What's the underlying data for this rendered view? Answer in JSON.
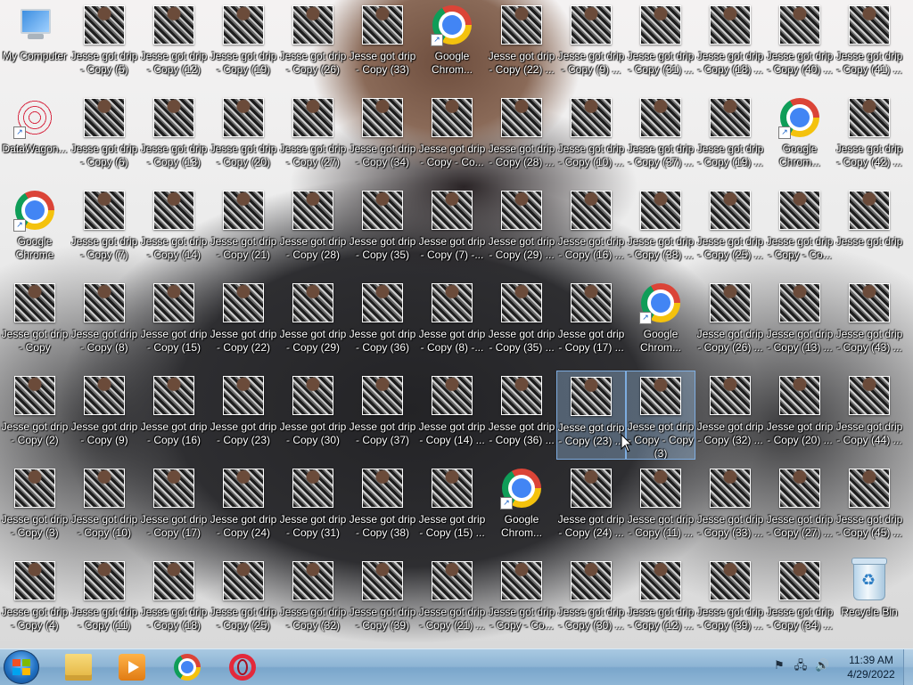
{
  "desktop": {
    "icons": [
      {
        "label": "My Computer",
        "type": "computer"
      },
      {
        "label": "Jesse got drip - Copy (5)",
        "type": "photo"
      },
      {
        "label": "Jesse got drip - Copy (12)",
        "type": "photo"
      },
      {
        "label": "Jesse got drip - Copy (19)",
        "type": "photo"
      },
      {
        "label": "Jesse got drip - Copy (26)",
        "type": "photo"
      },
      {
        "label": "Jesse got drip - Copy (33)",
        "type": "photo"
      },
      {
        "label": "Google Chrom...",
        "type": "chrome"
      },
      {
        "label": "Jesse got drip - Copy (22) ...",
        "type": "photo"
      },
      {
        "label": "Jesse got drip - Copy (9) ...",
        "type": "photo"
      },
      {
        "label": "Jesse got drip - Copy (31) ...",
        "type": "photo"
      },
      {
        "label": "Jesse got drip - Copy (18) ...",
        "type": "photo"
      },
      {
        "label": "Jesse got drip - Copy (40) ...",
        "type": "photo"
      },
      {
        "label": "Jesse got drip - Copy (41) ...",
        "type": "photo"
      },
      {
        "label": "DataWagon...",
        "type": "datawagon"
      },
      {
        "label": "Jesse got drip - Copy (6)",
        "type": "photo"
      },
      {
        "label": "Jesse got drip - Copy (13)",
        "type": "photo"
      },
      {
        "label": "Jesse got drip - Copy (20)",
        "type": "photo"
      },
      {
        "label": "Jesse got drip - Copy (27)",
        "type": "photo"
      },
      {
        "label": "Jesse got drip - Copy (34)",
        "type": "photo"
      },
      {
        "label": "Jesse got drip - Copy - Co...",
        "type": "photo"
      },
      {
        "label": "Jesse got drip - Copy (28) ...",
        "type": "photo"
      },
      {
        "label": "Jesse got drip - Copy (10) ...",
        "type": "photo"
      },
      {
        "label": "Jesse got drip - Copy (37) ...",
        "type": "photo"
      },
      {
        "label": "Jesse got drip - Copy (19) ...",
        "type": "photo"
      },
      {
        "label": "Google Chrom...",
        "type": "chrome"
      },
      {
        "label": "Jesse got drip - Copy (42) ...",
        "type": "photo"
      },
      {
        "label": "Google Chrome",
        "type": "chrome"
      },
      {
        "label": "Jesse got drip - Copy (7)",
        "type": "photo"
      },
      {
        "label": "Jesse got drip - Copy (14)",
        "type": "photo"
      },
      {
        "label": "Jesse got drip - Copy (21)",
        "type": "photo"
      },
      {
        "label": "Jesse got drip - Copy (28)",
        "type": "photo"
      },
      {
        "label": "Jesse got drip - Copy (35)",
        "type": "photo"
      },
      {
        "label": "Jesse got drip - Copy (7) -...",
        "type": "photo"
      },
      {
        "label": "Jesse got drip - Copy (29) ...",
        "type": "photo"
      },
      {
        "label": "Jesse got drip - Copy (16) ...",
        "type": "photo"
      },
      {
        "label": "Jesse got drip - Copy (38) ...",
        "type": "photo"
      },
      {
        "label": "Jesse got drip - Copy (25) ...",
        "type": "photo"
      },
      {
        "label": "Jesse got drip - Copy - Co...",
        "type": "photo"
      },
      {
        "label": "Jesse got drip",
        "type": "photo"
      },
      {
        "label": "Jesse got drip - Copy",
        "type": "photo"
      },
      {
        "label": "Jesse got drip - Copy (8)",
        "type": "photo"
      },
      {
        "label": "Jesse got drip - Copy (15)",
        "type": "photo"
      },
      {
        "label": "Jesse got drip - Copy (22)",
        "type": "photo"
      },
      {
        "label": "Jesse got drip - Copy (29)",
        "type": "photo"
      },
      {
        "label": "Jesse got drip - Copy (36)",
        "type": "photo"
      },
      {
        "label": "Jesse got drip - Copy (8) -...",
        "type": "photo"
      },
      {
        "label": "Jesse got drip - Copy (35) ...",
        "type": "photo"
      },
      {
        "label": "Jesse got drip - Copy (17) ...",
        "type": "photo"
      },
      {
        "label": "Google Chrom...",
        "type": "chrome"
      },
      {
        "label": "Jesse got drip - Copy (26) ...",
        "type": "photo"
      },
      {
        "label": "Jesse got drip - Copy (13) ...",
        "type": "photo"
      },
      {
        "label": "Jesse got drip - Copy (43) ...",
        "type": "photo"
      },
      {
        "label": "Jesse got drip - Copy (2)",
        "type": "photo"
      },
      {
        "label": "Jesse got drip - Copy (9)",
        "type": "photo"
      },
      {
        "label": "Jesse got drip - Copy (16)",
        "type": "photo"
      },
      {
        "label": "Jesse got drip - Copy (23)",
        "type": "photo"
      },
      {
        "label": "Jesse got drip - Copy (30)",
        "type": "photo"
      },
      {
        "label": "Jesse got drip - Copy (37)",
        "type": "photo"
      },
      {
        "label": "Jesse got drip - Copy (14) ...",
        "type": "photo"
      },
      {
        "label": "Jesse got drip - Copy (36) ...",
        "type": "photo"
      },
      {
        "label": "Jesse got drip - Copy (23) ...",
        "type": "photo",
        "selected": true
      },
      {
        "label": "Jesse got drip - Copy - Copy (3)",
        "type": "photo",
        "selected": true
      },
      {
        "label": "Jesse got drip - Copy (32) ...",
        "type": "photo"
      },
      {
        "label": "Jesse got drip - Copy (20) ...",
        "type": "photo"
      },
      {
        "label": "Jesse got drip - Copy (44) ...",
        "type": "photo"
      },
      {
        "label": "Jesse got drip - Copy (3)",
        "type": "photo"
      },
      {
        "label": "Jesse got drip - Copy (10)",
        "type": "photo"
      },
      {
        "label": "Jesse got drip - Copy (17)",
        "type": "photo"
      },
      {
        "label": "Jesse got drip - Copy (24)",
        "type": "photo"
      },
      {
        "label": "Jesse got drip - Copy (31)",
        "type": "photo"
      },
      {
        "label": "Jesse got drip - Copy (38)",
        "type": "photo"
      },
      {
        "label": "Jesse got drip - Copy (15) ...",
        "type": "photo"
      },
      {
        "label": "Google Chrom...",
        "type": "chrome"
      },
      {
        "label": "Jesse got drip - Copy (24) ...",
        "type": "photo"
      },
      {
        "label": "Jesse got drip - Copy (11) ...",
        "type": "photo"
      },
      {
        "label": "Jesse got drip - Copy (33) ...",
        "type": "photo"
      },
      {
        "label": "Jesse got drip - Copy (27) ...",
        "type": "photo"
      },
      {
        "label": "Jesse got drip - Copy (45) ...",
        "type": "photo"
      },
      {
        "label": "Jesse got drip - Copy (4)",
        "type": "photo"
      },
      {
        "label": "Jesse got drip - Copy (11)",
        "type": "photo"
      },
      {
        "label": "Jesse got drip - Copy (18)",
        "type": "photo"
      },
      {
        "label": "Jesse got drip - Copy (25)",
        "type": "photo"
      },
      {
        "label": "Jesse got drip - Copy (32)",
        "type": "photo"
      },
      {
        "label": "Jesse got drip - Copy (39)",
        "type": "photo"
      },
      {
        "label": "Jesse got drip - Copy (21) ...",
        "type": "photo"
      },
      {
        "label": "Jesse got drip - Copy - Co...",
        "type": "photo"
      },
      {
        "label": "Jesse got drip - Copy (30) ...",
        "type": "photo"
      },
      {
        "label": "Jesse got drip - Copy (12) ...",
        "type": "photo"
      },
      {
        "label": "Jesse got drip - Copy (39) ...",
        "type": "photo"
      },
      {
        "label": "Jesse got drip - Copy (34) ...",
        "type": "photo"
      },
      {
        "label": "Recycle Bin",
        "type": "recycle-bin"
      }
    ]
  },
  "taskbar": {
    "apps": [
      {
        "name": "windows-explorer",
        "icon": "folder-icon"
      },
      {
        "name": "media-player",
        "icon": "media-player-icon"
      },
      {
        "name": "google-chrome",
        "icon": "chrome-icon"
      },
      {
        "name": "opera",
        "icon": "opera-icon"
      }
    ],
    "tray": {
      "icons": [
        "action-center-flag-icon",
        "network-icon",
        "volume-icon"
      ],
      "time": "11:39 AM",
      "date": "4/29/2022"
    }
  }
}
